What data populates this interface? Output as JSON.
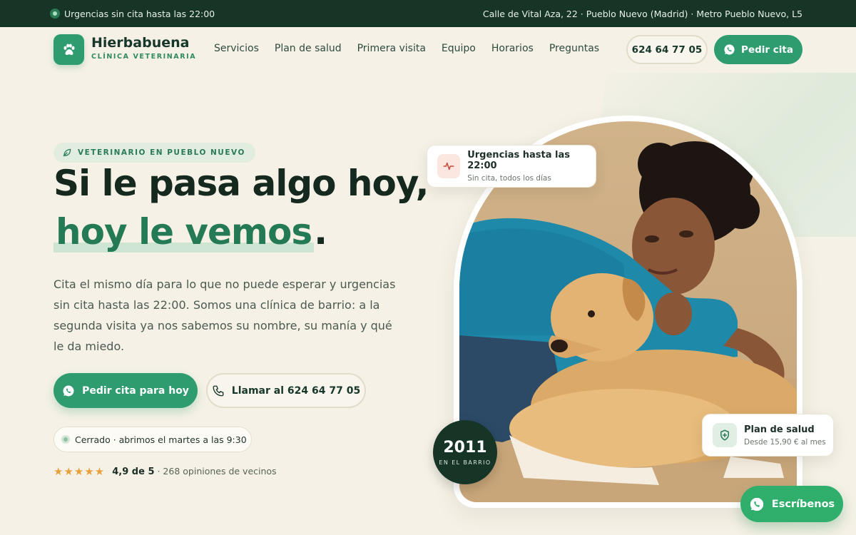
{
  "topbar": {
    "urgent_text": "Urgencias sin cita hasta las 22:00",
    "address": "Calle de Vital Aza, 22 · Pueblo Nuevo (Madrid) · Metro Pueblo Nuevo, L5"
  },
  "brand": {
    "name": "Hierbabuena",
    "subtitle": "CLÍNICA VETERINARIA",
    "logo_icon": "paw-icon"
  },
  "nav": {
    "items": [
      {
        "label": "Servicios"
      },
      {
        "label": "Plan de salud"
      },
      {
        "label": "Primera visita"
      },
      {
        "label": "Equipo"
      },
      {
        "label": "Horarios"
      },
      {
        "label": "Preguntas"
      }
    ],
    "phone_button": "624 64 77 05",
    "cita_button": "Pedir cita"
  },
  "hero": {
    "tag": "VETERINARIO EN PUEBLO NUEVO",
    "headline_line1": "Si le pasa algo hoy,",
    "headline_highlight": "hoy le vemos",
    "headline_period": ".",
    "lead": "Cita el mismo día para lo que no puede esperar y urgencias sin cita hasta las 22:00. Somos una clínica de barrio: a la segunda visita ya nos sabemos su nombre, su manía y qué le da miedo.",
    "cta_primary": "Pedir cita para hoy",
    "cta_secondary": "Llamar al 624 64 77 05",
    "status": "Cerrado · abrimos el martes a las 9:30",
    "rating": {
      "stars": 5,
      "score": "4,9 de 5",
      "reviews": "· 268 opiniones de vecinos"
    }
  },
  "cards": {
    "urgencias": {
      "title": "Urgencias hasta las 22:00",
      "subtitle": "Sin cita, todos los días"
    },
    "plan": {
      "title": "Plan de salud",
      "subtitle": "Desde 15,90 € al mes"
    }
  },
  "badge": {
    "year": "2011",
    "label": "EN EL BARRIO"
  },
  "chat_button": "Escríbenos",
  "colors": {
    "brand_green": "#2f9c70",
    "dark_green": "#163527",
    "background": "#f5f1e6",
    "star": "#e8a13a",
    "whatsapp": "#2fae6c"
  }
}
